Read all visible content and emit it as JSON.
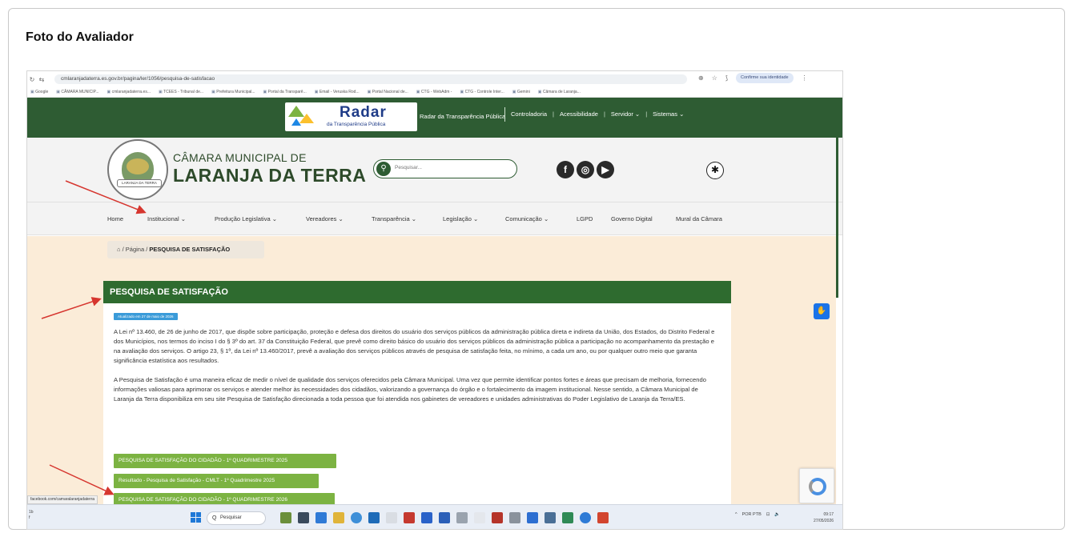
{
  "card_title": "Foto do Avaliador",
  "browser": {
    "url": "cmlaranjadaterra.es.gov.br/pagina/ler/1056/pesquisa-de-satisfacao",
    "profile_label": "Confirme sua identidade",
    "bookmarks": [
      "Google",
      "CÂMARA MUNICIP...",
      "cmlaranjadaterra.es...",
      "TCEES - Tribunal de...",
      "Prefeitura Municipal...",
      "Portal da Transparê...",
      "Email - Veruska Rod...",
      "Portal Nacional de...",
      "CTG - WebAdm -",
      "CTG - Controle Inter...",
      "Gemini",
      "Câmara de Laranja..."
    ]
  },
  "topbar": {
    "radar_word": "Radar",
    "radar_sub": "da Transparência Pública",
    "radar_text": "Radar da Transparência Pública",
    "links": [
      "Controladoria",
      "Acessibilidade",
      "Servidor ⌄",
      "Sistemas ⌄"
    ]
  },
  "header": {
    "line1": "CÂMARA MUNICIPAL DE",
    "line2": "LARANJA DA TERRA",
    "seal_ribbon": "LARANJA DA TERRA",
    "search_placeholder": "Pesquisar...",
    "social": [
      "f",
      "◎",
      "▶"
    ],
    "a11y_glyph": "✱"
  },
  "nav": [
    "Home",
    "Institucional ⌄",
    "Produção Legislativa ⌄",
    "Vereadores ⌄",
    "Transparência ⌄",
    "Legislação ⌄",
    "Comunicação ⌄",
    "LGPD",
    "Governo Digital",
    "Mural da Câmara"
  ],
  "breadcrumb": {
    "home_icon": "⌂",
    "page": "Página",
    "current": "PESQUISA DE SATISFAÇÃO"
  },
  "panel": {
    "title": "PESQUISA DE SATISFAÇÃO",
    "updated_badge": "Atualizado em 27 de maio de 2026",
    "para1": "A Lei nº 13.460, de 26 de junho de 2017, que dispõe sobre participação, proteção e defesa dos direitos do usuário dos serviços públicos da administração pública direta e indireta da União, dos Estados, do Distrito Federal e dos Municípios, nos termos do inciso I do § 3º do art. 37 da Constituição Federal, que prevê como direito básico do usuário dos serviços públicos da administração pública a participação no acompanhamento da prestação e na avaliação dos serviços. O artigo 23, § 1º, da Lei nº 13.460/2017, prevê a avaliação dos serviços públicos através de pesquisa de satisfação feita, no mínimo, a cada um ano, ou por qualquer outro meio que garanta significância estatística aos resultados.",
    "para2": "A Pesquisa de Satisfação é uma maneira eficaz de medir o nível de qualidade dos serviços oferecidos pela Câmara Municipal. Uma vez que permite identificar pontos fortes e áreas que precisam de melhoria, fornecendo informações valiosas para aprimorar os serviços e atender melhor às necessidades dos cidadãos, valorizando a governança do órgão e o fortalecimento da imagem institucional. Nesse sentido, a Câmara Municipal de Laranja da Terra disponibiliza em seu site Pesquisa de Satisfação direcionada a toda pessoa que foi atendida nos gabinetes de vereadores e unidades administrativas do Poder Legislativo de Laranja da Terra/ES.",
    "buttons": [
      "PESQUISA DE SATISFAÇÃO DO CIDADÃO - 1º QUADRIMESTRE 2025",
      "Resultado - Pesquisa de Satisfação - CMLT - 1º Quadrimestre 2025",
      "PESQUISA DE SATISFAÇÃO DO CIDADÃO - 1º QUADRIMESTRE 2026"
    ]
  },
  "status_url": "facebook.com/camaralaranjadaterra",
  "taskbar": {
    "left_text": [
      "1b",
      "f"
    ],
    "search": "Pesquisar",
    "tray": [
      "^",
      "POR PTB",
      "⊡",
      "🔈"
    ],
    "time": "09:17",
    "date": "27/05/2026"
  },
  "colors": {
    "brand_green": "#2e5c33",
    "panel_green": "#2e6b2f",
    "button_green": "#7cb342",
    "content_bg": "#fbecd8",
    "arrow_red": "#d6362f"
  }
}
